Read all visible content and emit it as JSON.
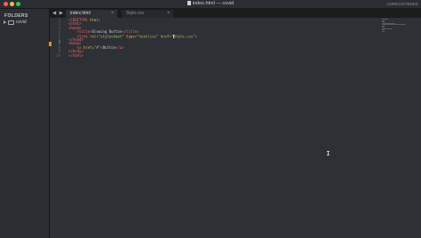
{
  "window": {
    "title": "index.html — covid",
    "unregistered_label": "UNREGISTERED"
  },
  "sidebar": {
    "header": "FOLDERS",
    "items": [
      {
        "label": "covid",
        "icon": "folder-icon",
        "expanded": false
      }
    ]
  },
  "tabs": [
    {
      "label": "index.html",
      "active": true,
      "close": "×"
    },
    {
      "label": "Style.css",
      "active": false,
      "close": "×"
    }
  ],
  "nav": {
    "back": "◀",
    "forward": "▶"
  },
  "editor": {
    "current_line": 7,
    "lines": [
      {
        "num": "1",
        "segments": [
          {
            "t": "<!DOCTYPE ",
            "c": "tag"
          },
          {
            "t": "html",
            "c": "attr"
          },
          {
            "t": ">",
            "c": "tag"
          }
        ]
      },
      {
        "num": "2",
        "segments": [
          {
            "t": "<html>",
            "c": "tag"
          }
        ]
      },
      {
        "num": "3",
        "segments": [
          {
            "t": "<head>",
            "c": "tag"
          }
        ]
      },
      {
        "num": "4",
        "segments": [
          {
            "t": "    ",
            "c": "ident"
          },
          {
            "t": "<title>",
            "c": "tag"
          },
          {
            "t": "Glowing Button",
            "c": "ident"
          },
          {
            "t": "</title>",
            "c": "tag"
          }
        ]
      },
      {
        "num": "5",
        "segments": [
          {
            "t": "    ",
            "c": "ident"
          },
          {
            "t": "<link ",
            "c": "tag"
          },
          {
            "t": "rel=",
            "c": "attr"
          },
          {
            "t": "\"stylesheet\"",
            "c": "str"
          },
          {
            "t": " type=",
            "c": "attr"
          },
          {
            "t": "\"text/css\"",
            "c": "str"
          },
          {
            "t": " href=",
            "c": "attr"
          },
          {
            "t": "\"",
            "c": "str"
          },
          {
            "t": "|",
            "c": "cursor"
          },
          {
            "t": "Style.css\"",
            "c": "str"
          },
          {
            "t": ">",
            "c": "tag"
          }
        ]
      },
      {
        "num": "6",
        "segments": [
          {
            "t": "</head>",
            "c": "tag"
          }
        ]
      },
      {
        "num": "7",
        "segments": [
          {
            "t": "<body>",
            "c": "tag"
          }
        ]
      },
      {
        "num": "8",
        "segments": [
          {
            "t": "    ",
            "c": "ident"
          },
          {
            "t": "<a ",
            "c": "tag"
          },
          {
            "t": "href=",
            "c": "attr"
          },
          {
            "t": "\"#\"",
            "c": "str"
          },
          {
            "t": ">",
            "c": "tag"
          },
          {
            "t": "Button",
            "c": "ident"
          },
          {
            "t": "</a>",
            "c": "tag"
          }
        ]
      },
      {
        "num": "9",
        "segments": [
          {
            "t": "</body>",
            "c": "tag"
          }
        ]
      },
      {
        "num": "10",
        "segments": [
          {
            "t": "</html>",
            "c": "tag"
          }
        ]
      }
    ]
  },
  "colors": {
    "tag": "#e16a6a",
    "attribute": "#d9b266",
    "string": "#a7c561",
    "line_marker": "#e58e2b"
  }
}
